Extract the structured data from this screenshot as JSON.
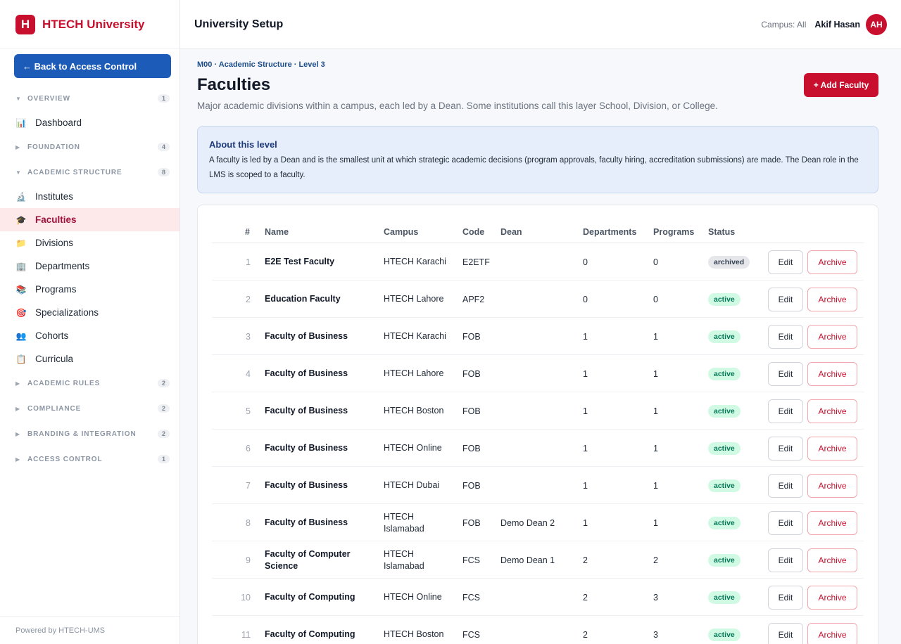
{
  "brand": {
    "logo_letter": "H",
    "name": "HTECH University"
  },
  "sidebar": {
    "back_label": "← Back to Access Control",
    "sections": [
      {
        "caret": "▼",
        "label": "OVERVIEW",
        "count": "1",
        "items": [
          {
            "icon": "📊",
            "label": "Dashboard"
          }
        ]
      },
      {
        "caret": "▶",
        "label": "FOUNDATION",
        "count": "4",
        "items": []
      },
      {
        "caret": "▼",
        "label": "ACADEMIC STRUCTURE",
        "count": "8",
        "items": [
          {
            "icon": "🔬",
            "label": "Institutes"
          },
          {
            "icon": "🎓",
            "label": "Faculties",
            "active": true
          },
          {
            "icon": "📁",
            "label": "Divisions"
          },
          {
            "icon": "🏢",
            "label": "Departments"
          },
          {
            "icon": "📚",
            "label": "Programs"
          },
          {
            "icon": "🎯",
            "label": "Specializations"
          },
          {
            "icon": "👥",
            "label": "Cohorts"
          },
          {
            "icon": "📋",
            "label": "Curricula"
          }
        ]
      },
      {
        "caret": "▶",
        "label": "ACADEMIC RULES",
        "count": "2",
        "items": []
      },
      {
        "caret": "▶",
        "label": "COMPLIANCE",
        "count": "2",
        "items": []
      },
      {
        "caret": "▶",
        "label": "BRANDING & INTEGRATION",
        "count": "2",
        "items": []
      },
      {
        "caret": "▶",
        "label": "ACCESS CONTROL",
        "count": "1",
        "items": []
      }
    ],
    "powered_by": "Powered by HTECH-UMS"
  },
  "header": {
    "title": "University Setup",
    "campus": "Campus: All",
    "user": "Akif Hasan",
    "avatar": "AH"
  },
  "main": {
    "breadcrumb": "M00 · Academic Structure · Level 3",
    "title": "Faculties",
    "subtitle": "Major academic divisions within a campus, each led by a Dean. Some institutions call this layer School, Division, or College.",
    "add_label": "+ Add Faculty",
    "about_title": "About this level",
    "about_text": "A faculty is led by a Dean and is the smallest unit at which strategic academic decisions (program approvals, faculty hiring, accreditation submissions) are made. The Dean role in the LMS is scoped to a faculty."
  },
  "table": {
    "headers": {
      "num": "#",
      "name": "Name",
      "campus": "Campus",
      "code": "Code",
      "dean": "Dean",
      "departments": "Departments",
      "programs": "Programs",
      "status": "Status"
    },
    "edit_label": "Edit",
    "archive_label": "Archive",
    "rows": [
      {
        "num": "1",
        "name": "E2E Test Faculty",
        "campus": "HTECH Karachi",
        "code": "E2ETF",
        "dean": "",
        "departments": "0",
        "programs": "0",
        "status": "archived"
      },
      {
        "num": "2",
        "name": "Education Faculty",
        "campus": "HTECH Lahore",
        "code": "APF2",
        "dean": "",
        "departments": "0",
        "programs": "0",
        "status": "active"
      },
      {
        "num": "3",
        "name": "Faculty of Business",
        "campus": "HTECH Karachi",
        "code": "FOB",
        "dean": "",
        "departments": "1",
        "programs": "1",
        "status": "active"
      },
      {
        "num": "4",
        "name": "Faculty of Business",
        "campus": "HTECH Lahore",
        "code": "FOB",
        "dean": "",
        "departments": "1",
        "programs": "1",
        "status": "active"
      },
      {
        "num": "5",
        "name": "Faculty of Business",
        "campus": "HTECH Boston",
        "code": "FOB",
        "dean": "",
        "departments": "1",
        "programs": "1",
        "status": "active"
      },
      {
        "num": "6",
        "name": "Faculty of Business",
        "campus": "HTECH Online",
        "code": "FOB",
        "dean": "",
        "departments": "1",
        "programs": "1",
        "status": "active"
      },
      {
        "num": "7",
        "name": "Faculty of Business",
        "campus": "HTECH Dubai",
        "code": "FOB",
        "dean": "",
        "departments": "1",
        "programs": "1",
        "status": "active"
      },
      {
        "num": "8",
        "name": "Faculty of Business",
        "campus": "HTECH Islamabad",
        "code": "FOB",
        "dean": "Demo Dean 2",
        "departments": "1",
        "programs": "1",
        "status": "active"
      },
      {
        "num": "9",
        "name": "Faculty of Computer Science",
        "campus": "HTECH Islamabad",
        "code": "FCS",
        "dean": "Demo Dean 1",
        "departments": "2",
        "programs": "2",
        "status": "active"
      },
      {
        "num": "10",
        "name": "Faculty of Computing",
        "campus": "HTECH Online",
        "code": "FCS",
        "dean": "",
        "departments": "2",
        "programs": "3",
        "status": "active"
      },
      {
        "num": "11",
        "name": "Faculty of Computing",
        "campus": "HTECH Boston",
        "code": "FCS",
        "dean": "",
        "departments": "2",
        "programs": "3",
        "status": "active"
      }
    ]
  }
}
